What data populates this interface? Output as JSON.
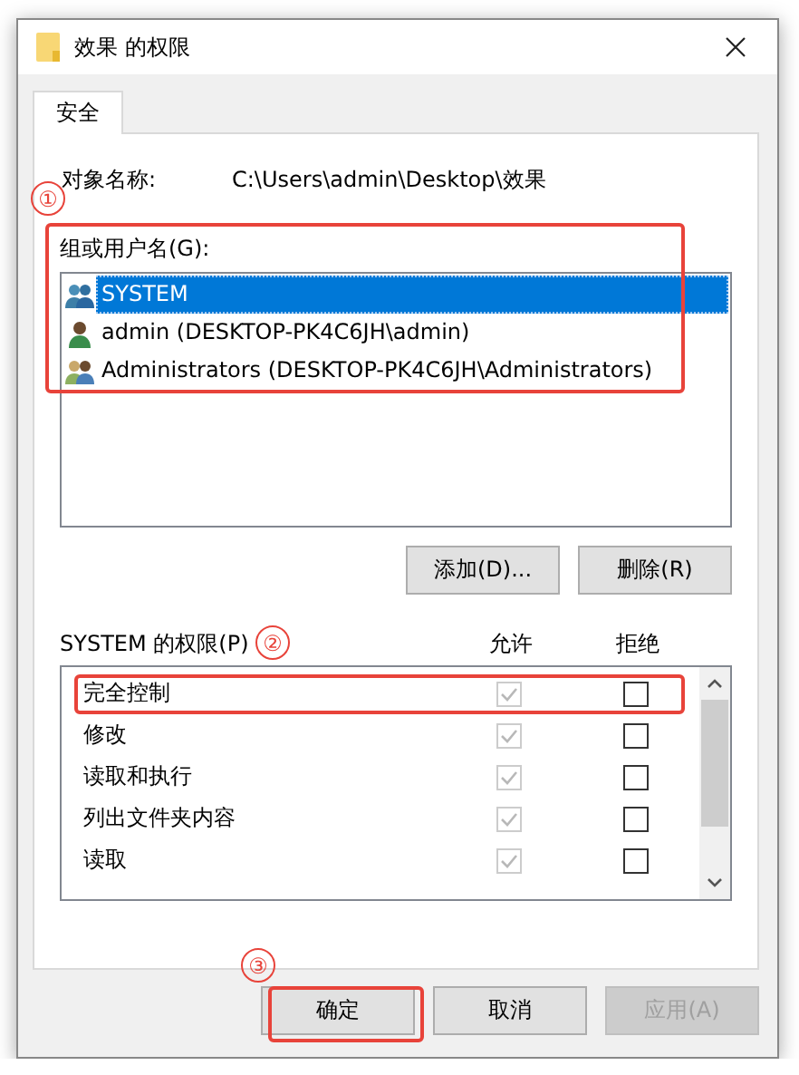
{
  "window": {
    "title": "效果 的权限"
  },
  "tabs": [
    {
      "label": "安全",
      "selected": true
    }
  ],
  "object_name": {
    "label": "对象名称:",
    "value": "C:\\Users\\admin\\Desktop\\效果"
  },
  "groups": {
    "label": "组或用户名(G):",
    "items": [
      {
        "name": "SYSTEM",
        "kind": "group",
        "selected": true
      },
      {
        "name": "admin (DESKTOP-PK4C6JH\\admin)",
        "kind": "user",
        "selected": false
      },
      {
        "name": "Administrators (DESKTOP-PK4C6JH\\Administrators)",
        "kind": "admins",
        "selected": false
      }
    ],
    "buttons": [
      "添加(D)...",
      "删除(R)"
    ]
  },
  "permissions": {
    "label": "SYSTEM 的权限(P)",
    "columns": [
      "允许",
      "拒绝"
    ],
    "rows": [
      {
        "name": "完全控制",
        "allow": true,
        "allow_disabled": true,
        "deny": false
      },
      {
        "name": "修改",
        "allow": true,
        "allow_disabled": true,
        "deny": false
      },
      {
        "name": "读取和执行",
        "allow": true,
        "allow_disabled": true,
        "deny": false
      },
      {
        "name": "列出文件夹内容",
        "allow": true,
        "allow_disabled": true,
        "deny": false
      },
      {
        "name": "读取",
        "allow": true,
        "allow_disabled": true,
        "deny": false
      }
    ]
  },
  "buttons": [
    {
      "label": "确定",
      "disabled": false
    },
    {
      "label": "取消",
      "disabled": false
    },
    {
      "label": "应用(A)",
      "disabled": true
    }
  ],
  "annotations": [
    {
      "number": "①"
    },
    {
      "number": "②"
    },
    {
      "number": "③"
    }
  ]
}
